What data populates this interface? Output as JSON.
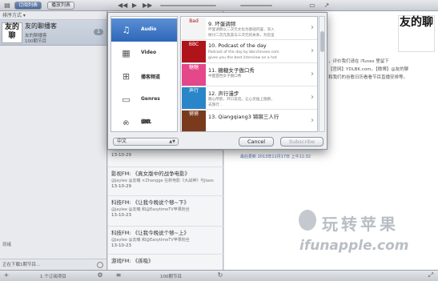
{
  "toolbar": {
    "subscriptions_tab": "订阅列表",
    "playlist_tab": "播放列表"
  },
  "sidebar": {
    "sort_label": "排序方式 ▾",
    "feed": {
      "logo_text": "友的聊",
      "title": "友的聊播客",
      "subtitle1": "友的聊播客",
      "subtitle2": "100期节目",
      "badge": "1"
    },
    "footer1": "就绪",
    "footer2": "正在下载1期节目..."
  },
  "list": {
    "episodes": [
      {
        "title": "",
        "sub": "",
        "date": "13-10-29"
      },
      {
        "title": "影视FM: 《真女版中的战争电影》",
        "sub": "@jaylee @友曦 ×Zhangge 在新电影《大战神》与Jiaos",
        "date": "13-10-29"
      },
      {
        "title": "科技FM: 《让我今晚说个够~下》",
        "sub": "@jaylee @友曦 和@EasytimeTV苹果粉丝",
        "date": "13-10-23"
      },
      {
        "title": "科技FM: 《让我今晚说个够~上》",
        "sub": "@jaylee @友曦 和@EasytimeTV苹果粉丝",
        "date": "13-10-23"
      },
      {
        "title": "游戏FM: 《孫吸》",
        "sub": "",
        "date": ""
      }
    ]
  },
  "detail": {
    "logo_text": "友的聊",
    "text1": "，评价我们请在 iTunes 里留下",
    "text2": "【官网】YDLBK.com。【微博】@友的聊",
    "text3": "和我们的谷歌日历看看节目直播安排等。",
    "meta": "最后更新 2013年11月17日 上午11:32"
  },
  "watermark": {
    "cn": "玩转苹果",
    "en": "ifunapple.com"
  },
  "bottombar": {
    "left": "1 个订阅项目",
    "mid": "100期节目"
  },
  "dialog": {
    "categories": [
      {
        "label": "Audio",
        "icon": "music-note-icon"
      },
      {
        "label": "Video",
        "icon": "film-icon"
      },
      {
        "label": "播客频道",
        "icon": "grid-icon"
      },
      {
        "label": "Genres",
        "icon": "tray-icon"
      },
      {
        "label": "搜索",
        "icon": "magnifier-icon"
      },
      {
        "label": "URL",
        "icon": "link-icon"
      }
    ],
    "results": [
      {
        "title": "9. 坏蛋调频",
        "sub1": "坏蛋调频以二次元文化为基础内容，深入",
        "sub2": "探讨二次元及其与三次元的关系，为您呈",
        "art_text": "Bad",
        "art_color": "#f4f4f4"
      },
      {
        "title": "10. Podcast of the day",
        "sub1": "Podcast of the day by bbcchinese.com",
        "sub2": "gives you the best interview on a hot",
        "art_text": "BBC",
        "art_color": "#b0141b"
      },
      {
        "title": "11. 糖糖女子傲口秀",
        "sub1": "中国首档女子脱口秀",
        "sub2": "",
        "art_text": "糖糖",
        "art_color": "#e4478a"
      },
      {
        "title": "12. 声行漫步",
        "sub1": "随心所欲，开口说话。让心灵插上翅膀，",
        "sub2": "去旅行…",
        "art_text": "声行",
        "art_color": "#2a86c8"
      },
      {
        "title": "13. Qiangqiang3 锵锵三人行",
        "sub1": "",
        "sub2": "",
        "art_text": "锵锵",
        "art_color": "#7a3a1e"
      }
    ],
    "language": "中文",
    "cancel_label": "Cancel",
    "subscribe_label": "Subscribe"
  }
}
